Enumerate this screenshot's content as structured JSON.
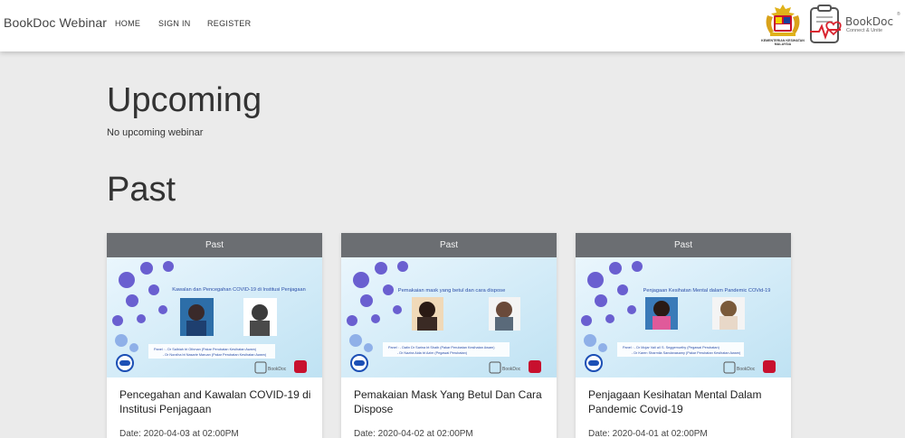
{
  "navbar": {
    "brand": "BookDoc Webinar",
    "links": [
      "HOME",
      "SIGN IN",
      "REGISTER"
    ],
    "gov_logo_caption": "KEMENTERIAN KESIHATAN MALAYSIA",
    "bookdoc_logo": {
      "word": "BookDoc",
      "tagline": "Connect & Unite",
      "reg": "®"
    }
  },
  "upcoming": {
    "heading": "Upcoming",
    "empty_text": "No upcoming webinar"
  },
  "past": {
    "heading": "Past",
    "cards": [
      {
        "badge": "Past",
        "thumb_title": "Kawalan dan Pencegahan COVID-19 di Institusi Penjagaan",
        "thumb_panel_1": "Panel : - Dr Salbiah bt Othman (Pakar Perubatan Kesihatan Awam)",
        "thumb_panel_2": "- Dr Norziha bt Nasarie Maruan (Pakar Perubatan Kesihatan Awam)",
        "title": "Pencegahan and Kawalan COVID-19 di Institusi Penjagaan",
        "date": "Date: 2020-04-03 at 02:00PM"
      },
      {
        "badge": "Past",
        "thumb_title": "Pemakaian mask yang betul dan cara dispose",
        "thumb_panel_1": "Panel : - Datin Dr Sarina bt Shaib (Pakar Perubatan Kesihatan Awam)",
        "thumb_panel_2": "- Dr Nazira Aida bt Azim (Pegawai Perubatan)",
        "title": "Pemakaian Mask Yang Betul Dan Cara Dispose",
        "date": "Date: 2020-04-02 at 02:00PM"
      },
      {
        "badge": "Past",
        "thumb_title": "Penjagaan Kesihatan Mental dalam Pandemic COVid-19",
        "thumb_panel_1": "Panel : - Dr Mojar Vali a/l S. Seggemurthy (Pegawai Perubatan)",
        "thumb_panel_2": "- Dr Karen Sharmila Sandanasamy (Pakar Perubatan Kesihatan Awam)",
        "title": "Penjagaan Kesihatan Mental Dalam Pandemic Covid-19",
        "date": "Date: 2020-04-01 at 02:00PM"
      }
    ]
  },
  "colors": {
    "page_bg": "#ebebeb",
    "card_header_bg": "#6b6e72",
    "virus": "#6a5fd0",
    "thumb_bg": "#cfe9f6",
    "bookdoc_red": "#d9232f"
  }
}
